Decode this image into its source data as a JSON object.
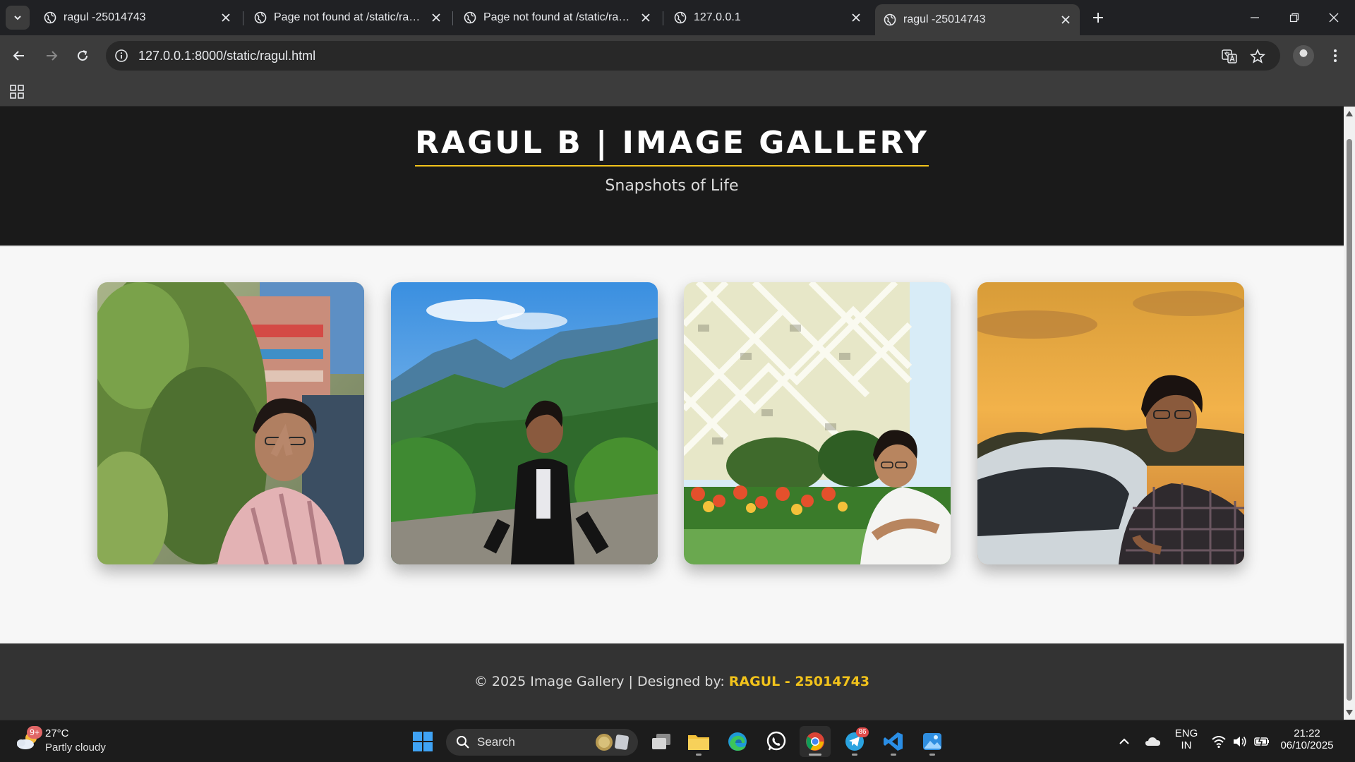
{
  "browser": {
    "tabs": [
      {
        "title": "ragul -25014743",
        "active": false
      },
      {
        "title": "Page not found at /static/ragul.",
        "active": false
      },
      {
        "title": "Page not found at /static/ragul.",
        "active": false
      },
      {
        "title": "127.0.0.1",
        "active": false
      },
      {
        "title": "ragul -25014743",
        "active": true
      }
    ],
    "url": "127.0.0.1:8000/static/ragul.html"
  },
  "page": {
    "title": "RAGUL B | IMAGE GALLERY",
    "subtitle": "Snapshots of Life",
    "accent_color": "#f2c31b",
    "header_bg": "#1a1a1a",
    "footer_bg": "#333333",
    "photos": [
      {
        "scene": "man touching face near green leafy plant and colorful temple tower"
      },
      {
        "scene": "man in black jacket sitting on wall with green mountains and blue sky"
      },
      {
        "scene": "man in white shirt in front of lattice-patterned building with flower garden"
      },
      {
        "scene": "man in checked shirt leaning on car at sunset"
      }
    ],
    "footer": {
      "text": "© 2025 Image Gallery | Designed by:",
      "author": "RAGUL - 25014743"
    }
  },
  "taskbar": {
    "weather": {
      "temp": "27°C",
      "condition": "Partly cloudy",
      "badge": "9+"
    },
    "search_label": "Search",
    "telegram_badge": "86",
    "language": {
      "line1": "ENG",
      "line2": "IN"
    },
    "clock": {
      "time": "21:22",
      "date": "06/10/2025"
    }
  }
}
